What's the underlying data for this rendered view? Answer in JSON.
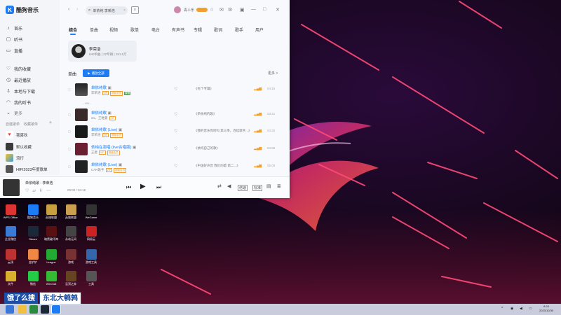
{
  "app": {
    "name": "酷狗音乐",
    "search_value": "单依纯 李荣浩",
    "user_name": "青人乐"
  },
  "sidebar": {
    "nav": [
      {
        "label": "首乐",
        "icon": "music-note-icon"
      },
      {
        "label": "听书",
        "icon": "book-icon"
      },
      {
        "label": "直播",
        "icon": "live-icon"
      },
      {
        "label": "我的收藏",
        "icon": "heart-icon"
      },
      {
        "label": "最近播放",
        "icon": "clock-icon"
      },
      {
        "label": "本地与下载",
        "icon": "download-icon"
      },
      {
        "label": "我的听书",
        "icon": "headphone-icon"
      },
      {
        "label": "更多",
        "icon": "chevron-down-icon"
      }
    ],
    "section_created": "自建歌单",
    "section_collected": "收藏歌单",
    "playlists": [
      {
        "label": "我喜欢"
      },
      {
        "label": "默认收藏"
      },
      {
        "label": "流行"
      },
      {
        "label": "HIFI2023年度歌单"
      }
    ]
  },
  "tabs": [
    "综合",
    "单曲",
    "视频",
    "歌单",
    "电台",
    "有声书",
    "专辑",
    "歌词",
    "歌手",
    "用户"
  ],
  "artist": {
    "name": "李荣浩",
    "stats": "540单曲 | 22专辑 | 151.5万"
  },
  "songs_section": {
    "title": "单曲",
    "play_all": "播放全部",
    "more": "更多 >"
  },
  "songs": [
    {
      "title": "单依纯歌",
      "artist": "李荣浩",
      "badges": [
        "VIP",
        "超级会员"
      ],
      "extra_badge": "原唱",
      "album": "《有个专辑》",
      "duration": "04:16",
      "sub": "...MV..."
    },
    {
      "title": "单依纯歌",
      "artist": "ws、王唯嘉",
      "badges": [
        "VIP"
      ],
      "extra_badge": "",
      "album": "《单依纯的歌》",
      "duration": "03:41",
      "sub": ""
    },
    {
      "title": "单依纯歌 (Live)",
      "artist": "李荣浩",
      "badges": [
        "VIP",
        "超级会员"
      ],
      "extra_badge": "",
      "album": "《我的音乐你听吗 第三季，连续歌手...》",
      "duration": "04:25",
      "sub": ""
    },
    {
      "title": "依纯在演唱 (live合唱版)",
      "artist": "王者",
      "badges": [
        "VIP",
        "超级会员"
      ],
      "extra_badge": "",
      "album": "《依纯自己的歌》",
      "duration": "04:58",
      "sub": ""
    },
    {
      "title": "单依纯歌 (Live)",
      "artist": "CAR歌手",
      "badges": [
        "VIP",
        "超级会员"
      ],
      "extra_badge": "",
      "album": "《中国好声音 我们的歌 第二...》",
      "duration": "05:00",
      "sub": ""
    }
  ],
  "player": {
    "title": "单依纯歌 - 李荣浩",
    "time": "00:00 / 04:16",
    "speed": "倍速",
    "quality": "标准"
  },
  "desktop_icons": [
    {
      "label": "WPS Office",
      "color": "#d33"
    },
    {
      "label": "酷狗音乐",
      "color": "#1b7cf5"
    },
    {
      "label": "英雄联盟",
      "color": "#c8a040"
    },
    {
      "label": "英雄联盟",
      "color": "#caa050"
    },
    {
      "label": "WeGame",
      "color": "#333"
    },
    {
      "label": "企业微信",
      "color": "#3a7bd5"
    },
    {
      "label": "Steam",
      "color": "#1b2838"
    },
    {
      "label": "暗黑破坏神",
      "color": "#5a1010"
    },
    {
      "label": "永劫无间",
      "color": "#444"
    },
    {
      "label": "网易云",
      "color": "#c22"
    },
    {
      "label": "云顶",
      "color": "#b33"
    },
    {
      "label": "金铲铲",
      "color": "#e84"
    },
    {
      "label": "League",
      "color": "#2a3"
    },
    {
      "label": "游戏",
      "color": "#733"
    },
    {
      "label": "游戏工具",
      "color": "#36a"
    },
    {
      "label": "文件",
      "color": "#d8b030"
    },
    {
      "label": "微信",
      "color": "#2c4"
    },
    {
      "label": "WeChat",
      "color": "#3b3"
    },
    {
      "label": "云顶之弈",
      "color": "#642"
    },
    {
      "label": "工具",
      "color": "#555"
    }
  ],
  "banner": {
    "left": "饿了么搜",
    "right": "东北大鹌鹑"
  },
  "taskbar": {
    "time": "8:24",
    "date": "2023/10/30"
  },
  "colors": {
    "accent": "#1b7cf5",
    "vip": "#f0a030"
  }
}
